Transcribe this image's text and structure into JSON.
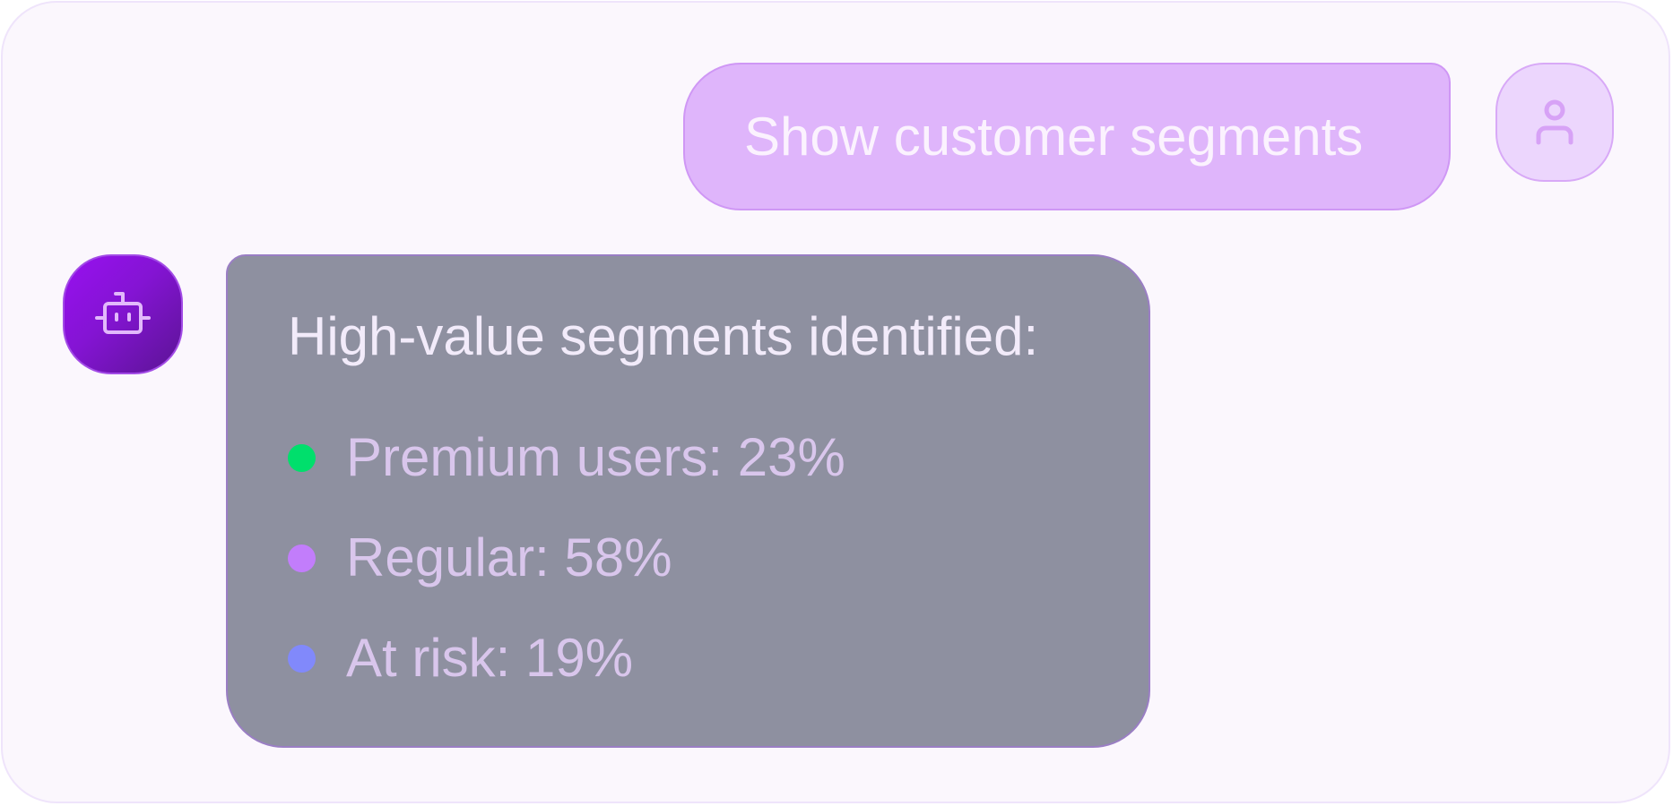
{
  "user_message": {
    "text": "Show customer segments",
    "avatar_icon": "user-icon"
  },
  "bot_message": {
    "avatar_icon": "robot-icon",
    "heading": "High-value segments identified:",
    "segments": [
      {
        "label": "Premium users: 23%",
        "color": "#00df6c"
      },
      {
        "label": "Regular: 58%",
        "color": "#c27dfb"
      },
      {
        "label": "At risk: 19%",
        "color": "#8189fb"
      }
    ]
  },
  "colors": {
    "user_bubble": "#dfb5fb",
    "bot_bubble": "#8e90a0",
    "bot_avatar_gradient": [
      "#9810f0",
      "#5b1494"
    ],
    "canvas": "#fbf7fd"
  }
}
